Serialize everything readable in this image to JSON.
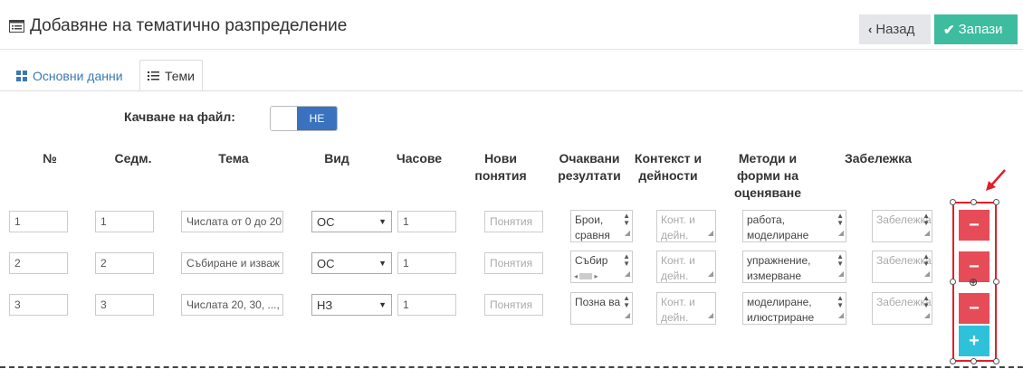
{
  "header": {
    "title": "Добавяне на тематично разпределение",
    "title_icon": "list-alt-icon",
    "back_label": "Назад",
    "save_label": "Запази",
    "save_color": "#3dbc9f"
  },
  "tabs": [
    {
      "label": "Основни данни",
      "icon": "grid-icon",
      "active": false
    },
    {
      "label": "Теми",
      "icon": "list-icon",
      "active": true
    }
  ],
  "upload": {
    "label": "Качване на файл:",
    "toggle_state": "НЕ"
  },
  "columns": {
    "num": "№",
    "week": "Седм.",
    "topic": "Тема",
    "type": "Вид",
    "hours": "Часове",
    "new_concepts": "Нови понятия",
    "expected": "Очаквани резултати",
    "context": "Контекст и дейности",
    "methods": "Методи и форми на оценяване",
    "note": "Забележка"
  },
  "placeholders": {
    "concepts": "Понятия",
    "context": "Конт. и дейн.",
    "note": "Забележка"
  },
  "rows": [
    {
      "num": "1",
      "week": "1",
      "topic": "Числата от 0 до 20",
      "type": "ОС",
      "hours": "1",
      "expected": "Брои, сравня",
      "methods": "работа, моделиране"
    },
    {
      "num": "2",
      "week": "2",
      "topic": "Събиране и изваж",
      "type": "ОС",
      "hours": "1",
      "expected": "Събир",
      "methods": "упражнение, измерване"
    },
    {
      "num": "3",
      "week": "3",
      "topic": "Числата 20, 30, ..., ",
      "type": "НЗ",
      "hours": "1",
      "expected": "Позна ва",
      "methods": "моделиране, илюстриране"
    }
  ],
  "row_buttons": {
    "remove": "−",
    "add": "+"
  },
  "colors": {
    "remove": "#e64c58",
    "add": "#2fc1d9",
    "highlight": "#e0202a",
    "link": "#3a78b5",
    "toggle": "#3a72c0"
  }
}
